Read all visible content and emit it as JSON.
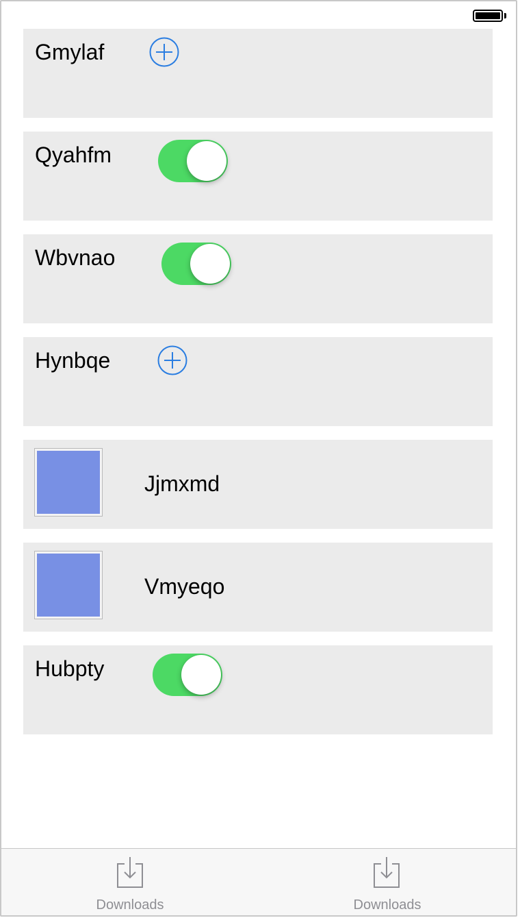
{
  "colors": {
    "cell_background": "#ebebeb",
    "toggle_on": "#4cd964",
    "add_icon": "#2a7de1",
    "thumbnail": "#7890e4",
    "tab_inactive": "#8e8e93"
  },
  "status_bar": {
    "battery_icon": "battery-full-icon"
  },
  "rows": [
    {
      "label": "Gmylaf",
      "control": "add-button",
      "icon": "plus-circle-icon"
    },
    {
      "label": "Qyahfm",
      "control": "toggle",
      "on": true
    },
    {
      "label": "Wbvnao",
      "control": "toggle",
      "on": true
    },
    {
      "label": "Hynbqe",
      "control": "add-button",
      "icon": "plus-circle-icon"
    },
    {
      "label": "Jjmxmd",
      "control": "thumbnail"
    },
    {
      "label": "Vmyeqo",
      "control": "thumbnail"
    },
    {
      "label": "Hubpty",
      "control": "toggle",
      "on": true
    }
  ],
  "tab_bar": {
    "tabs": [
      {
        "label": "Downloads",
        "icon": "download-tray-icon"
      },
      {
        "label": "Downloads",
        "icon": "download-tray-icon"
      }
    ]
  }
}
